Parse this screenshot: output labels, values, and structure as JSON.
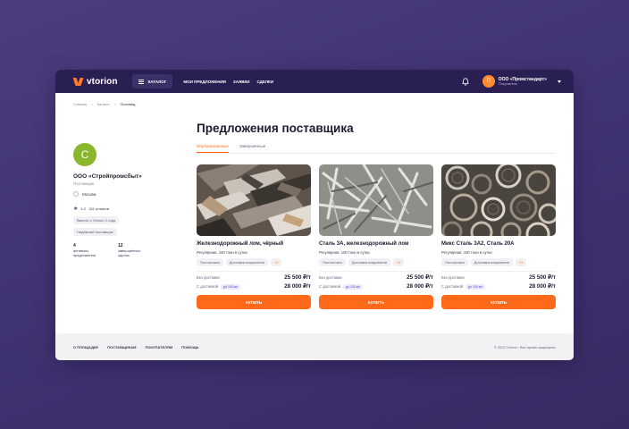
{
  "header": {
    "logo": "vtorion",
    "catalog_label": "Каталог",
    "nav": [
      "Мои предложения",
      "Заявки",
      "Сделки"
    ],
    "user_initial": "П",
    "user_name": "ООО «Промстандарт»",
    "user_role": "Покупатель"
  },
  "breadcrumb": [
    "Главная",
    "Каталог",
    "Поставщ.."
  ],
  "seller": {
    "initial": "С",
    "name": "ООО «Стройпромсбыт»",
    "type": "Поставщик",
    "city": "Москва",
    "rating": "4.2",
    "reviews": "126 отзывов",
    "tags": [
      "Вместе с Vtorion 2 года",
      "Надёжный поставщик"
    ],
    "stats": [
      {
        "num": "4",
        "label": "активных предложения"
      },
      {
        "num": "12",
        "label": "завершённых сделок"
      }
    ]
  },
  "main": {
    "title": "Предложения поставщика",
    "tabs": [
      "Опубликованные",
      "Завершённые"
    ]
  },
  "cards": [
    {
      "title": "Железнодорожный лом, чёрный",
      "subtitle": "Регулярная, 100 тонн в сутки",
      "chips": [
        "Постоплата",
        "Доставка покупателя",
        "+2"
      ],
      "price_no_delivery_label": "Без доставки",
      "price_no_delivery": "25 500 ₽/т",
      "price_delivery_label": "С доставкой",
      "distance": "до 100 км",
      "price_delivery": "28 000 ₽/т",
      "buy_label": "Купить"
    },
    {
      "title": "Сталь 3А, железнодорожный лом",
      "subtitle": "Регулярная, 100 тонн в сутки",
      "chips": [
        "Постоплата",
        "Доставка покупателя",
        "+2"
      ],
      "price_no_delivery_label": "Без доставки",
      "price_no_delivery": "25 500 ₽/т",
      "price_delivery_label": "С доставкой",
      "distance": "до 100 км",
      "price_delivery": "28 000 ₽/т",
      "buy_label": "Купить"
    },
    {
      "title": "Микс Сталь 3А2, Сталь 20А",
      "subtitle": "Регулярная, 100 тонн в сутки",
      "chips": [
        "Постоплата",
        "Доставка покупателя",
        "+2"
      ],
      "price_no_delivery_label": "Без доставки",
      "price_no_delivery": "25 500 ₽/т",
      "price_delivery_label": "С доставкой",
      "distance": "до 100 км",
      "price_delivery": "28 000 ₽/т",
      "buy_label": "Купить"
    }
  ],
  "footer": {
    "links": [
      "О площадке",
      "Поставщикам",
      "Покупателям",
      "Помощь"
    ],
    "copyright": "© 2022 Vtorion. Все права защищены"
  },
  "colors": {
    "background": "#43367a",
    "header": "#2a1f52",
    "accent": "#ff6a1a",
    "seller_avatar": "#8ab62c",
    "user_avatar": "#ff8a30"
  }
}
